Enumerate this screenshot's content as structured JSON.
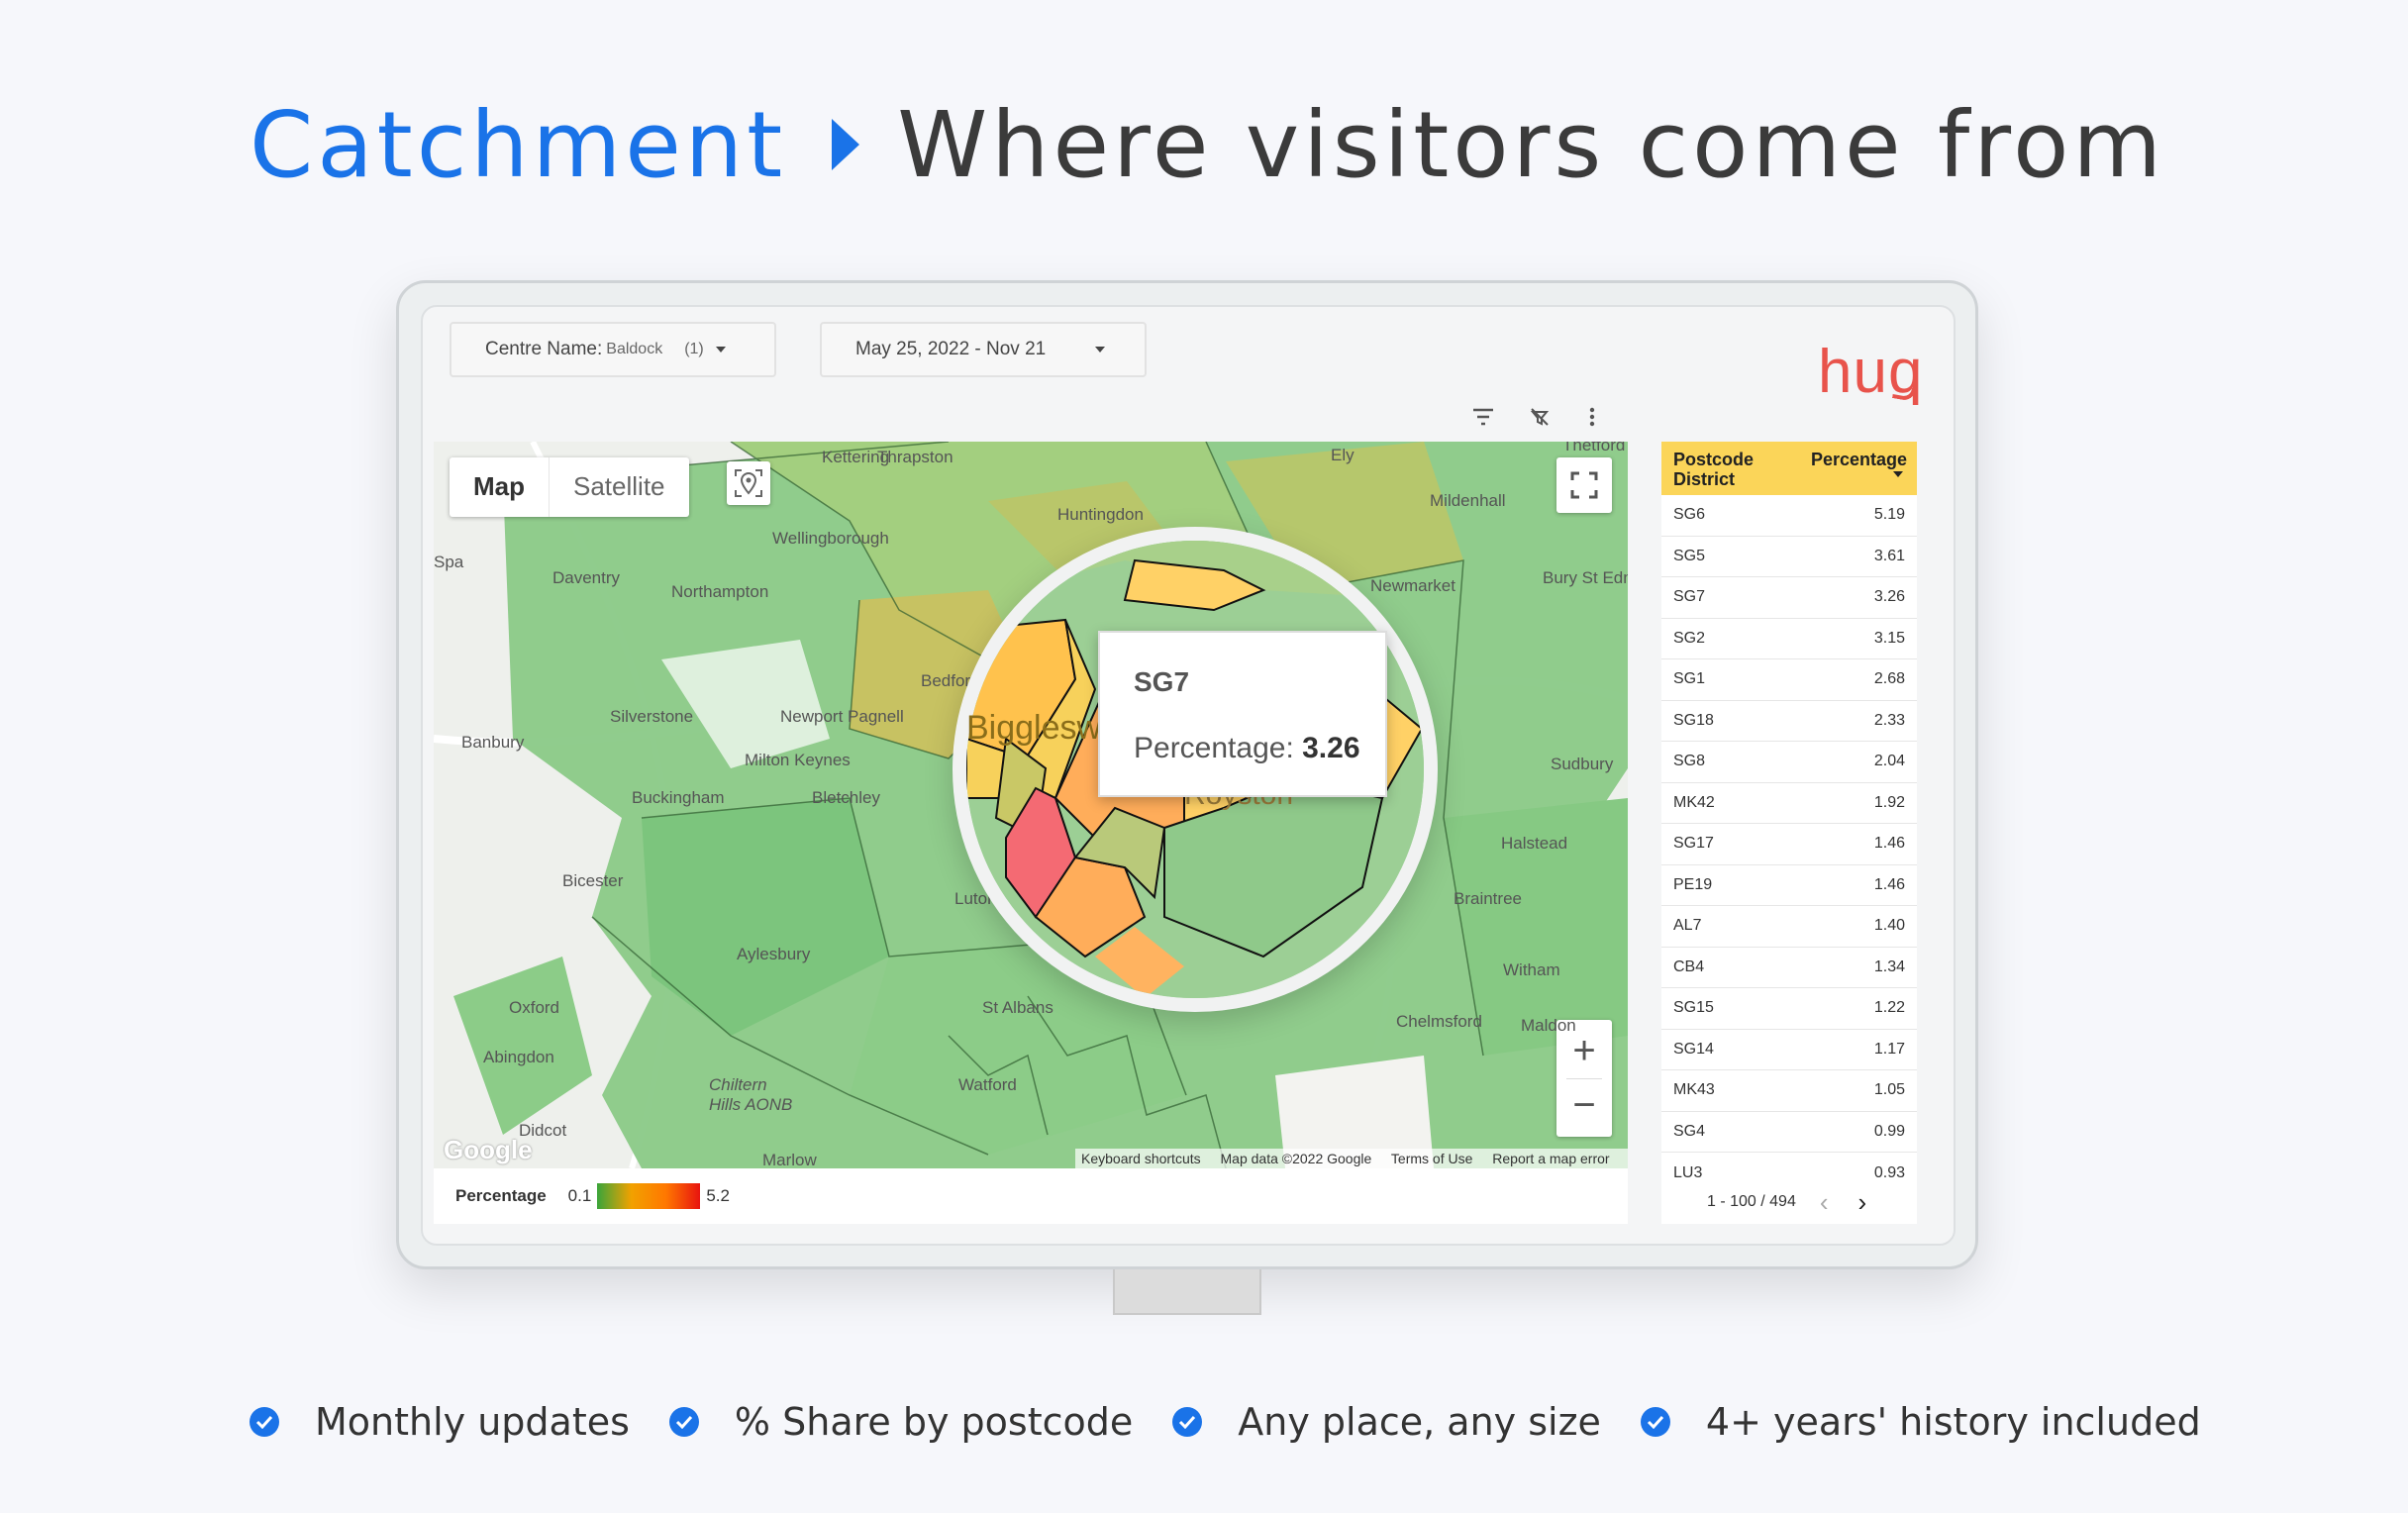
{
  "headline": {
    "part1": "Catchment",
    "part2": "Where visitors come from"
  },
  "filters": {
    "centre_label": "Centre Name:",
    "centre_value": "Baldock",
    "centre_count": "(1)",
    "date_range": "May 25, 2022 - Nov 21"
  },
  "brand": {
    "logo": "huq",
    "color": "#e8534b"
  },
  "map": {
    "type_map": "Map",
    "type_satellite": "Satellite",
    "places": [
      "Kettering",
      "Thrapston",
      "Ely",
      "Thetford",
      "Huntingdon",
      "Mildenhall",
      "Wellingborough",
      "Spa",
      "Daventry",
      "Northampton",
      "Newmarket",
      "Bury St Edmunds",
      "Bedford",
      "Newport Pagnell",
      "Silverstone",
      "Milton Keynes",
      "Banbury",
      "Sudbury",
      "Buckingham",
      "Bletchley",
      "Halstead",
      "Bicester",
      "Braintree",
      "Luton",
      "Aylesbury",
      "Witham",
      "Oxford",
      "St Albans",
      "Chelmsford",
      "Maldon",
      "Abingdon",
      "Chiltern Hills AONB",
      "Watford",
      "Didcot",
      "Marlow",
      "Biggleswade",
      "Royston"
    ],
    "attribution": [
      "Keyboard shortcuts",
      "Map data ©2022 Google",
      "Terms of Use",
      "Report a map error"
    ],
    "google": "Google",
    "zoom_in": "+",
    "zoom_out": "−"
  },
  "tooltip": {
    "title": "SG7",
    "label": "Percentage:",
    "value": "3.26"
  },
  "legend": {
    "title": "Percentage",
    "min": "0.1",
    "max": "5.2"
  },
  "table": {
    "col1": "Postcode District",
    "col2": "Percentage",
    "rows": [
      {
        "d": "SG6",
        "p": "5.19"
      },
      {
        "d": "SG5",
        "p": "3.61"
      },
      {
        "d": "SG7",
        "p": "3.26"
      },
      {
        "d": "SG2",
        "p": "3.15"
      },
      {
        "d": "SG1",
        "p": "2.68"
      },
      {
        "d": "SG18",
        "p": "2.33"
      },
      {
        "d": "SG8",
        "p": "2.04"
      },
      {
        "d": "MK42",
        "p": "1.92"
      },
      {
        "d": "SG17",
        "p": "1.46"
      },
      {
        "d": "PE19",
        "p": "1.46"
      },
      {
        "d": "AL7",
        "p": "1.40"
      },
      {
        "d": "CB4",
        "p": "1.34"
      },
      {
        "d": "SG15",
        "p": "1.22"
      },
      {
        "d": "SG14",
        "p": "1.17"
      },
      {
        "d": "MK43",
        "p": "1.05"
      },
      {
        "d": "SG4",
        "p": "0.99"
      },
      {
        "d": "LU3",
        "p": "0.93"
      }
    ],
    "pager": "1 - 100 / 494"
  },
  "features": [
    "Monthly updates",
    "% Share by postcode",
    "Any place, any size",
    "4+ years' history included"
  ],
  "colors": {
    "accent": "#1a73e8",
    "header": "#fbd559"
  }
}
